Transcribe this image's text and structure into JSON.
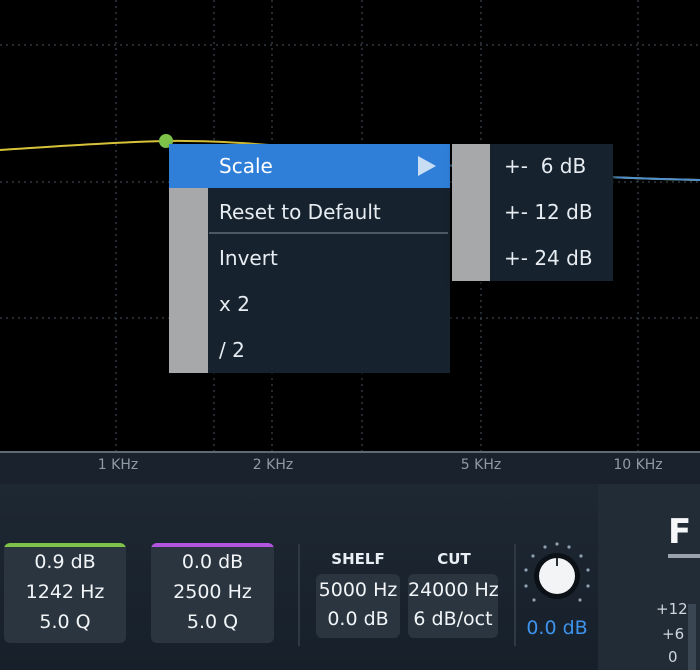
{
  "context_menu": {
    "items": [
      {
        "label": "Scale",
        "has_submenu": true,
        "highlighted": true
      },
      {
        "label": "Reset to Default"
      },
      {
        "label": "Invert"
      },
      {
        "label": "x 2"
      },
      {
        "label": "/ 2"
      }
    ],
    "submenu": {
      "items": [
        {
          "label": "+-  6 dB"
        },
        {
          "label": "+- 12 dB"
        },
        {
          "label": "+- 24 dB"
        }
      ]
    }
  },
  "axis": {
    "labels": [
      "1 KHz",
      "2 KHz",
      "5 KHz",
      "10 KHz"
    ]
  },
  "bands": [
    {
      "gain": "0.9 dB",
      "freq": "1242 Hz",
      "q": "5.0 Q",
      "color": "#7fc24a"
    },
    {
      "gain": "0.0 dB",
      "freq": "2500 Hz",
      "q": "5.0 Q",
      "color": "#b455e0"
    }
  ],
  "shelf": {
    "label": "SHELF",
    "freq": "5000 Hz",
    "gain": "0.0 dB"
  },
  "cut": {
    "label": "CUT",
    "freq": "24000 Hz",
    "slope": "6 dB/oct"
  },
  "output_gain": {
    "value": "0.0 dB",
    "color": "#3d93ee"
  },
  "logo": {
    "text": "F"
  },
  "meter": {
    "labels": [
      "+12",
      "+6",
      "0"
    ]
  },
  "colors": {
    "menu_highlight": "#2f7fd9",
    "curve_yellow": "#d8c23a",
    "curve_blue": "#4e8fd0",
    "node_green": "#7fc24a"
  }
}
